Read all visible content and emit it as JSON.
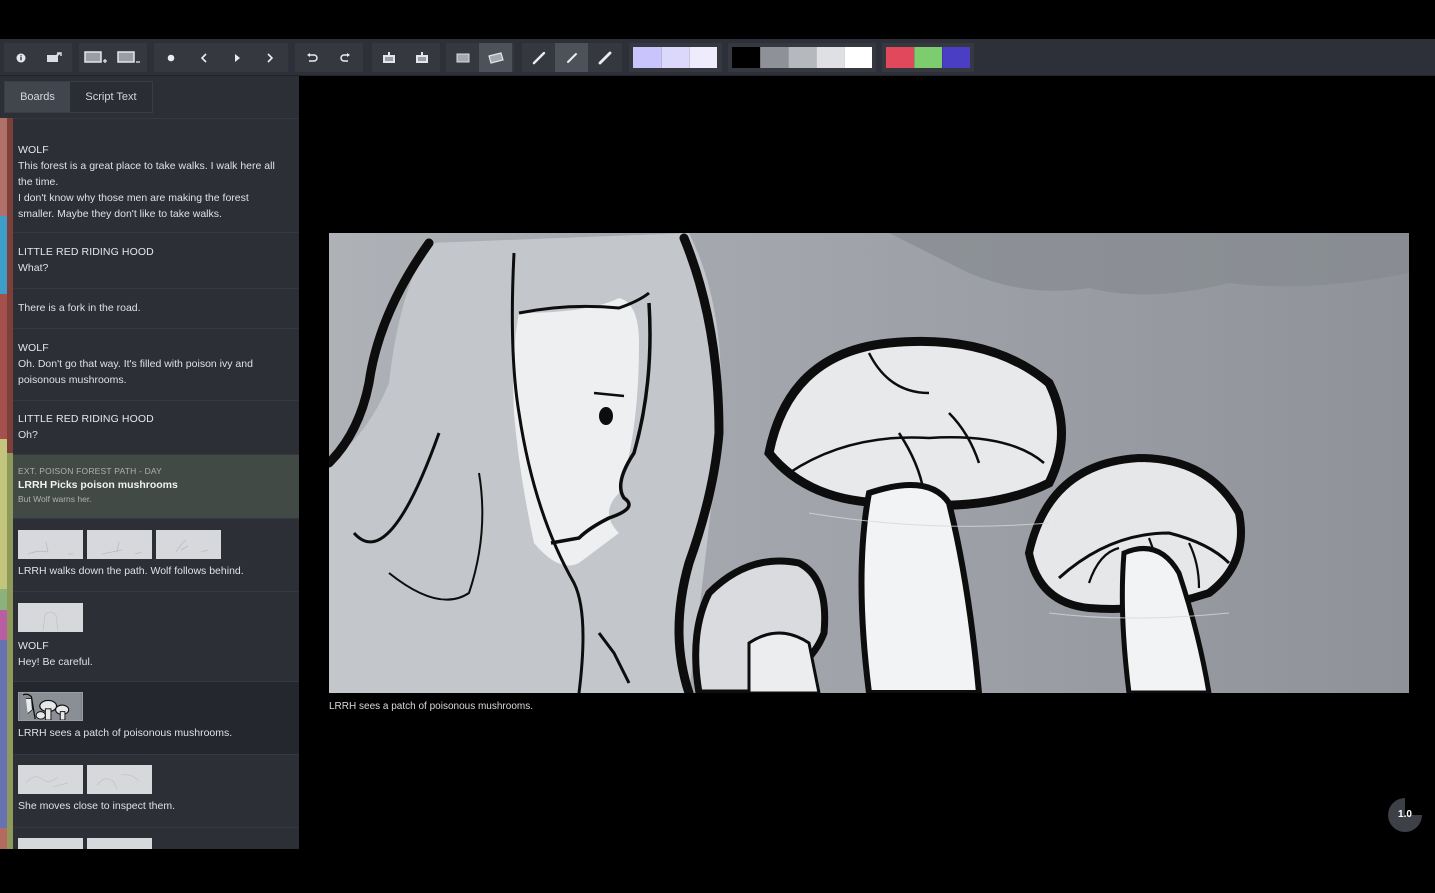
{
  "toolbar": {
    "groups": [
      {
        "name": "info",
        "buttons": [
          {
            "icon": "info-icon"
          },
          {
            "icon": "export-board-icon"
          }
        ]
      },
      {
        "name": "boards",
        "buttons": [
          {
            "icon": "add-board-icon"
          },
          {
            "icon": "remove-board-icon"
          }
        ]
      },
      {
        "name": "playback",
        "buttons": [
          {
            "icon": "record-dot-icon"
          },
          {
            "icon": "previous-icon"
          },
          {
            "icon": "play-icon"
          },
          {
            "icon": "next-icon"
          }
        ]
      },
      {
        "name": "history",
        "buttons": [
          {
            "icon": "undo-icon"
          },
          {
            "icon": "redo-icon"
          }
        ]
      },
      {
        "name": "layers",
        "buttons": [
          {
            "icon": "copy-board-icon"
          },
          {
            "icon": "paste-board-icon"
          }
        ]
      },
      {
        "name": "light-table",
        "buttons": [
          {
            "icon": "onion-skin-icon"
          },
          {
            "icon": "light-table-icon",
            "active": true
          }
        ]
      },
      {
        "name": "brushes",
        "buttons": [
          {
            "icon": "pencil-icon"
          },
          {
            "icon": "pen-icon",
            "active": true
          },
          {
            "icon": "brush-icon"
          }
        ]
      }
    ],
    "palettes": {
      "light_palette": [
        "#c9c4fb",
        "#dbd8fb",
        "#edebfc"
      ],
      "gray_palette": [
        "#000000",
        "#8e9197",
        "#b5b8bd",
        "#dfe0e3",
        "#ffffff"
      ],
      "accent_palette": [
        "#e2485c",
        "#7dcc6e",
        "#4a3fc4"
      ]
    }
  },
  "sidebar": {
    "tabs": [
      {
        "label": "Boards",
        "active": true
      },
      {
        "label": "Script Text",
        "active": false
      }
    ],
    "items": [
      {
        "type": "dialogue",
        "character": "WOLF",
        "lines": [
          "This forest is a great place to take walks. I walk here all",
          "the time.",
          "I don't know why those men are making the forest",
          "smaller. Maybe they don't like to take walks."
        ]
      },
      {
        "type": "dialogue",
        "character": "LITTLE RED RIDING HOOD",
        "lines": [
          "What?"
        ]
      },
      {
        "type": "action",
        "lines": [
          "There is a fork in the road."
        ]
      },
      {
        "type": "dialogue",
        "character": "WOLF",
        "lines": [
          "Oh. Don't go that way. It's filled with poison ivy and",
          "poisonous mushrooms."
        ]
      },
      {
        "type": "dialogue",
        "character": "LITTLE RED RIDING HOOD",
        "lines": [
          "Oh?"
        ]
      },
      {
        "type": "scene",
        "slug": "EXT. POISON FOREST PATH - DAY",
        "title": "LRRH Picks poison mushrooms",
        "subtitle": "But Wolf warns her."
      },
      {
        "type": "boards",
        "thumbnails": 3,
        "lines": [
          "LRRH walks down the path. Wolf follows behind."
        ]
      },
      {
        "type": "boards",
        "thumbnails": 1,
        "character": "WOLF",
        "lines": [
          "Hey! Be careful."
        ]
      },
      {
        "type": "boards",
        "thumbnails": 1,
        "selected": true,
        "lines": [
          "LRRH sees a patch of poisonous mushrooms."
        ]
      },
      {
        "type": "boards",
        "thumbnails": 2,
        "lines": [
          "She moves close to inspect them."
        ]
      },
      {
        "type": "boards",
        "thumbnails": 2,
        "lines": []
      }
    ]
  },
  "main": {
    "caption": "LRRH sees a patch of poisonous mushrooms.",
    "zoom_level": "1.0"
  }
}
